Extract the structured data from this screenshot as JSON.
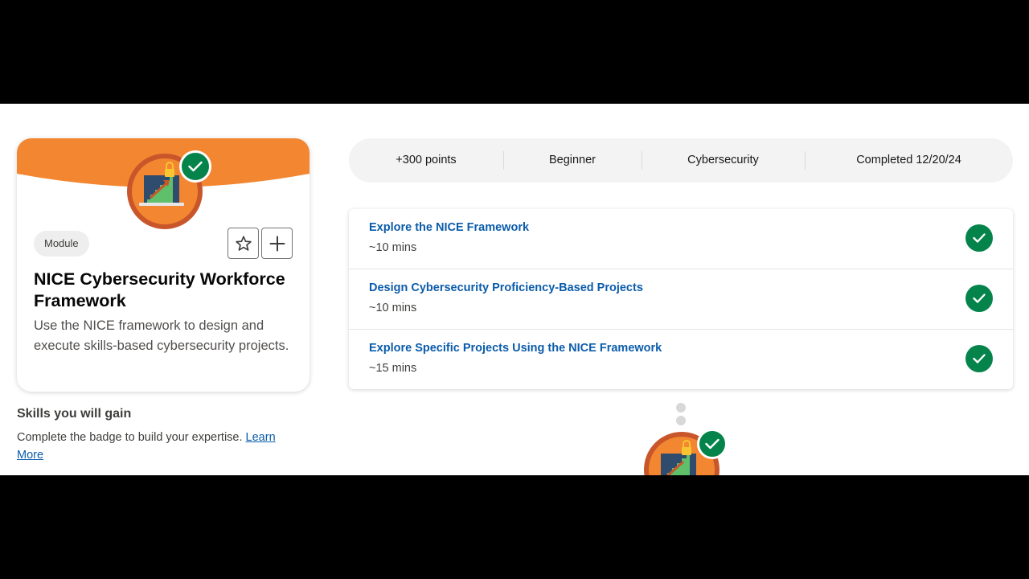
{
  "module": {
    "type_label": "Module",
    "title": "NICE Cybersecurity Workforce Framework",
    "description": "Use the NICE framework to design and execute skills-based cybersecurity projects.",
    "badge_icon": "laptop-staircase-lock-badge",
    "favorite_icon": "star-outline-icon",
    "add_icon": "plus-icon"
  },
  "skills": {
    "title": "Skills you will gain",
    "description": "Complete the badge to build your expertise.",
    "link_label": "Learn More"
  },
  "stats": {
    "points": "+300 points",
    "level": "Beginner",
    "topic": "Cybersecurity",
    "completed": "Completed 12/20/24"
  },
  "units": [
    {
      "title": "Explore the NICE Framework",
      "duration": "~10 mins",
      "status": "completed"
    },
    {
      "title": "Design Cybersecurity Proficiency-Based Projects",
      "duration": "~10 mins",
      "status": "completed"
    },
    {
      "title": "Explore Specific Projects Using the NICE Framework",
      "duration": "~15 mins",
      "status": "completed"
    }
  ],
  "colors": {
    "banner_orange": "#f38630",
    "success_green": "#04844b",
    "link_blue": "#0b5cab"
  }
}
